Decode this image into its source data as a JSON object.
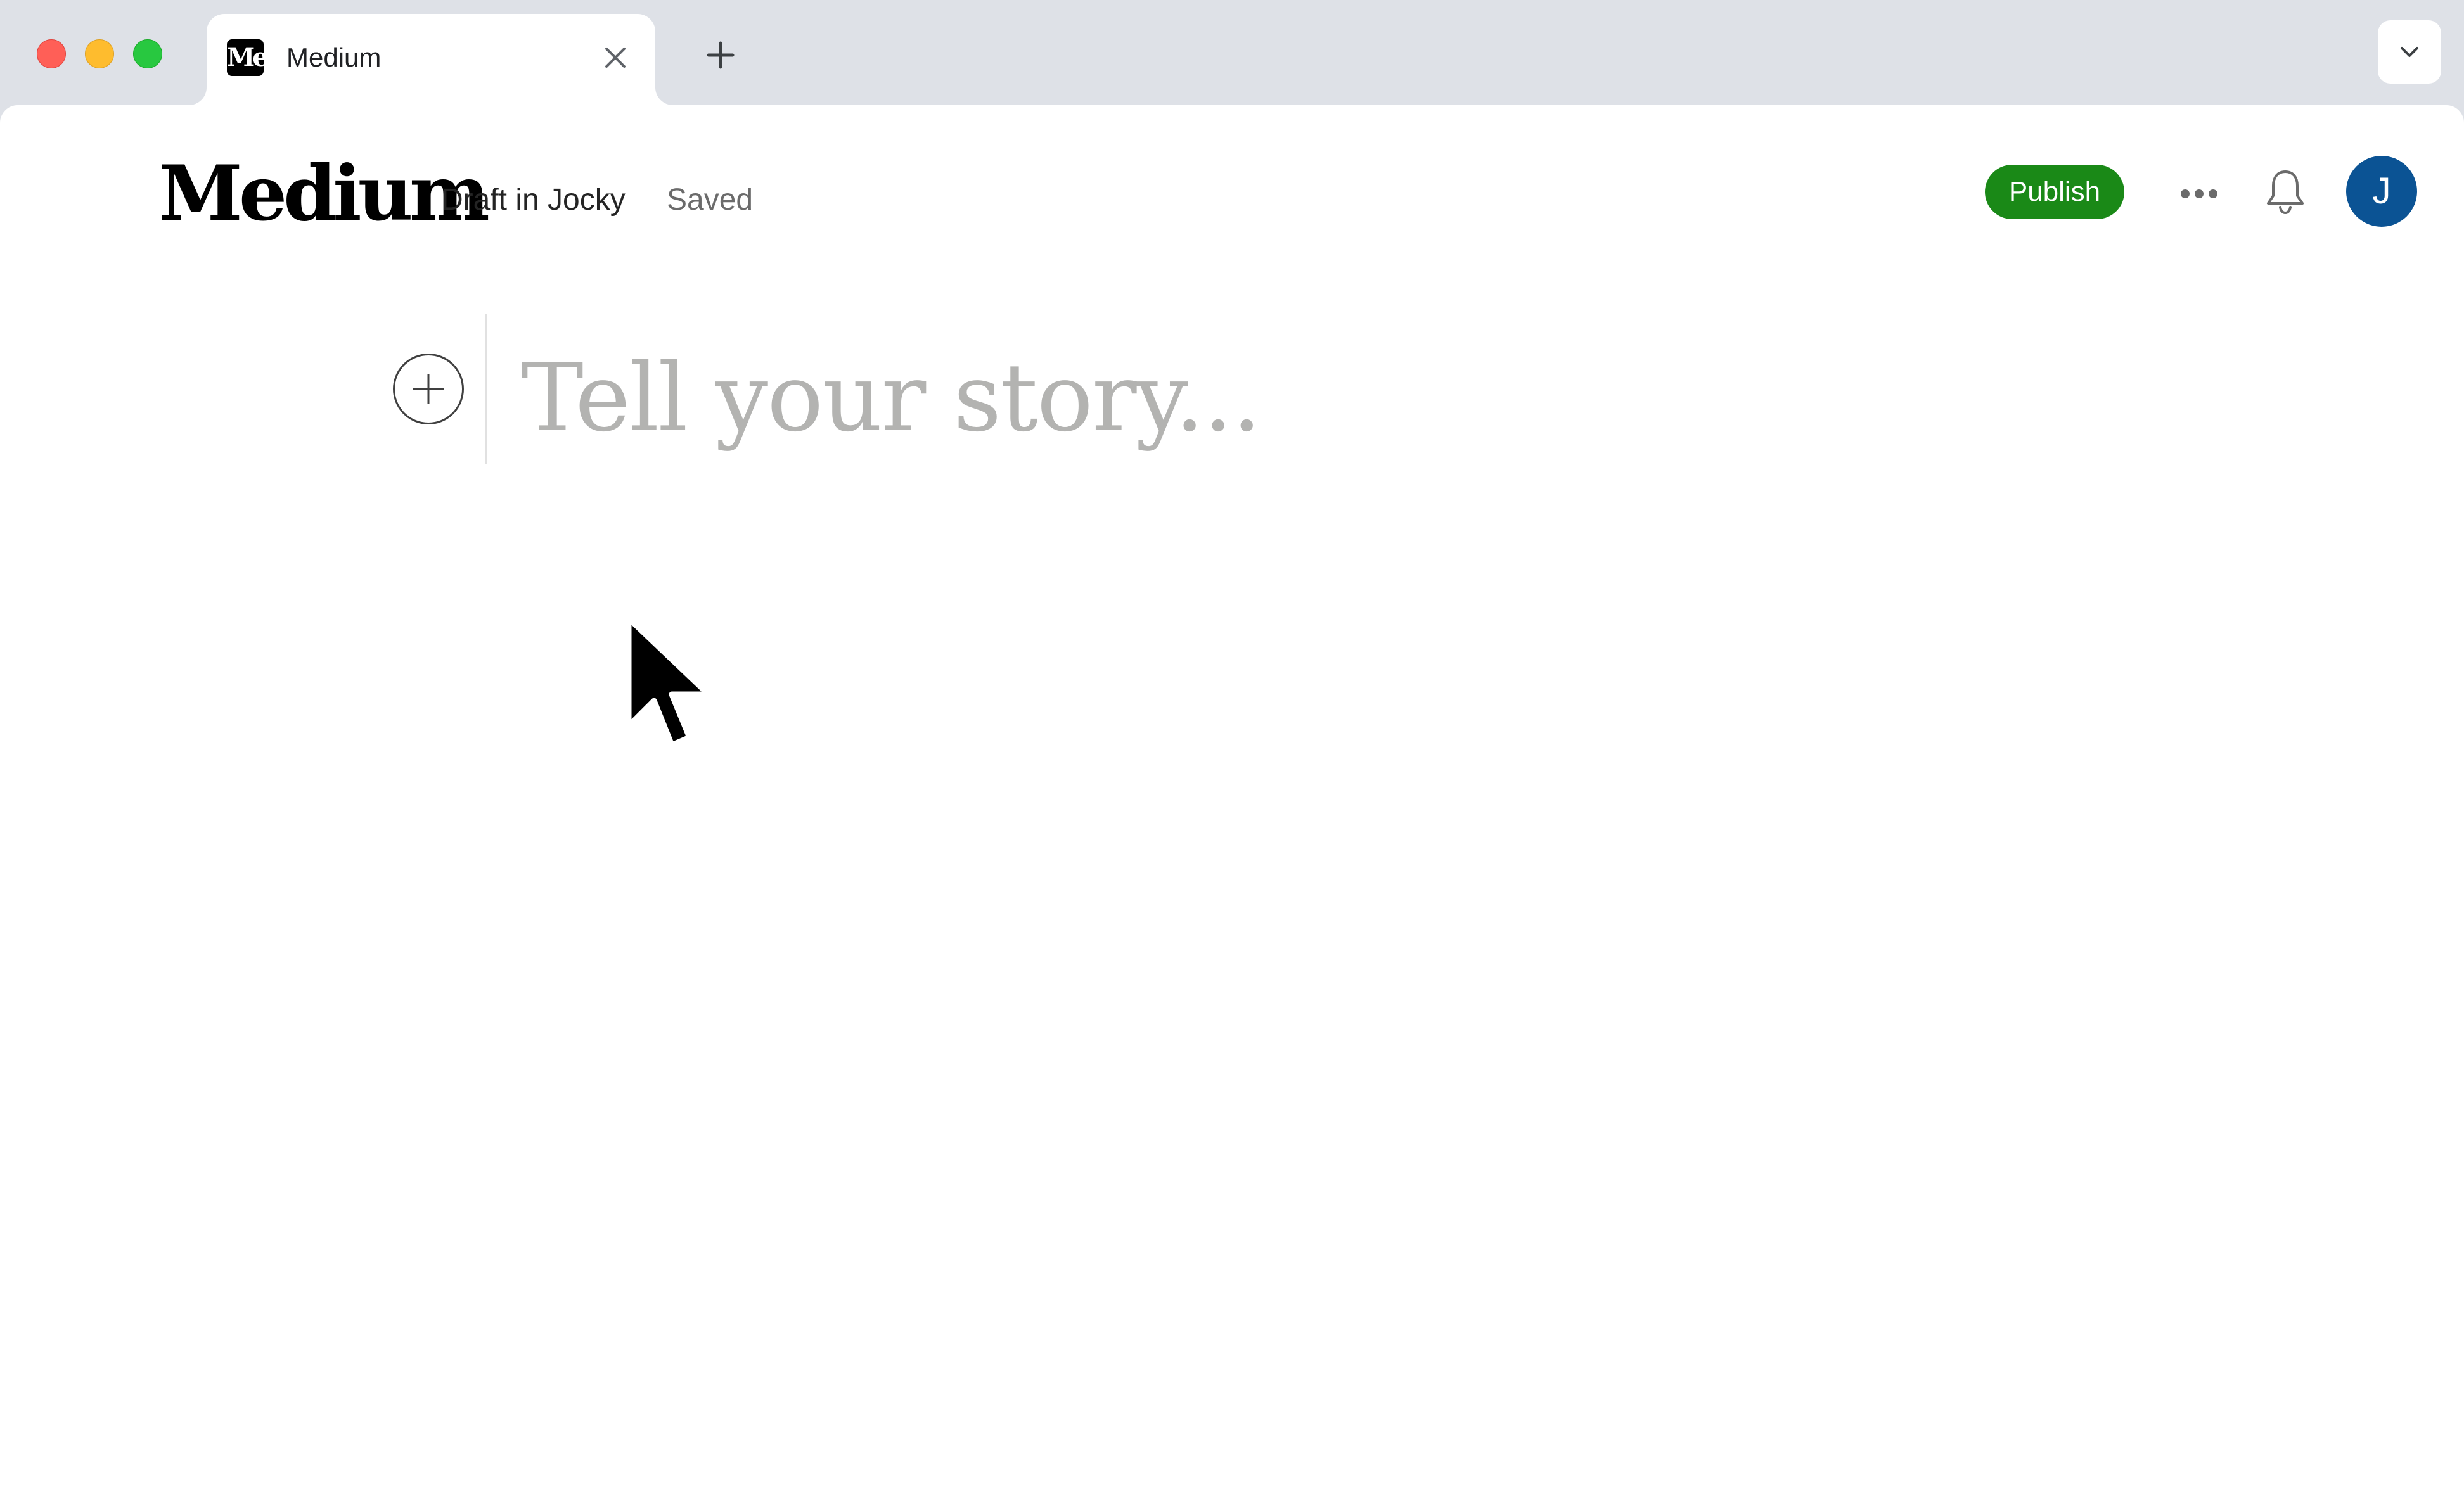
{
  "browser": {
    "tab": {
      "favicon_text": "Me",
      "title": "Medium",
      "close_icon": "close-icon"
    },
    "new_tab_icon": "plus-icon",
    "tab_list_icon": "chevron-down-icon"
  },
  "header": {
    "logo": "Medium",
    "draft_label": "Draft in Jocky",
    "saved_label": "Saved",
    "publish_label": "Publish",
    "more_icon": "more-horizontal-icon",
    "bell_icon": "bell-icon",
    "avatar_initial": "J"
  },
  "editor": {
    "add_block_icon": "plus-circle-icon",
    "placeholder": "Tell your story..."
  },
  "colors": {
    "publish": "#1a8917",
    "avatar": "#0b5394",
    "placeholder": "#b3b3b1"
  }
}
